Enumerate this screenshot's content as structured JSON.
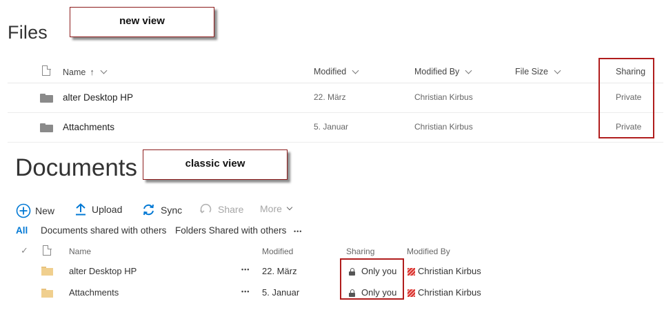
{
  "callouts": {
    "new_view": "new view",
    "classic_view": "classic view"
  },
  "new_view": {
    "title": "Files",
    "columns": {
      "name": "Name",
      "sort_indicator": "↑",
      "modified": "Modified",
      "modified_by": "Modified By",
      "file_size": "File Size",
      "sharing": "Sharing"
    },
    "rows": [
      {
        "name": "alter Desktop HP",
        "modified": "22. März",
        "modified_by": "Christian Kirbus",
        "file_size": "",
        "sharing": "Private"
      },
      {
        "name": "Attachments",
        "modified": "5. Januar",
        "modified_by": "Christian Kirbus",
        "file_size": "",
        "sharing": "Private"
      }
    ]
  },
  "classic_view": {
    "title": "Documents",
    "commands": {
      "new": "New",
      "upload": "Upload",
      "sync": "Sync",
      "share": "Share",
      "more": "More"
    },
    "tabs": {
      "all": "All",
      "shared_docs": "Documents shared with others",
      "shared_folders": "Folders Shared with others",
      "overflow": "•••"
    },
    "columns": {
      "check": "✓",
      "name": "Name",
      "modified": "Modified",
      "sharing": "Sharing",
      "modified_by": "Modified By"
    },
    "rows": [
      {
        "name": "alter Desktop HP",
        "ellipsis": "•••",
        "modified": "22. März",
        "sharing": "Only you",
        "modified_by": "Christian Kirbus"
      },
      {
        "name": "Attachments",
        "ellipsis": "•••",
        "modified": "5. Januar",
        "sharing": "Only you",
        "modified_by": "Christian Kirbus"
      }
    ]
  },
  "colors": {
    "accent": "#0078d4",
    "highlight_border": "#b01c1c",
    "folder_classic": "#f0cf8e",
    "folder_modern": "#8a8a8a"
  },
  "icons": {
    "file_type": "document-icon",
    "new": "plus-circle-icon",
    "upload": "upload-arrow-icon",
    "sync": "sync-icon",
    "share": "share-icon",
    "more": "chevron-down-icon",
    "sharing": "lock-icon",
    "presence": "presence-icon"
  }
}
